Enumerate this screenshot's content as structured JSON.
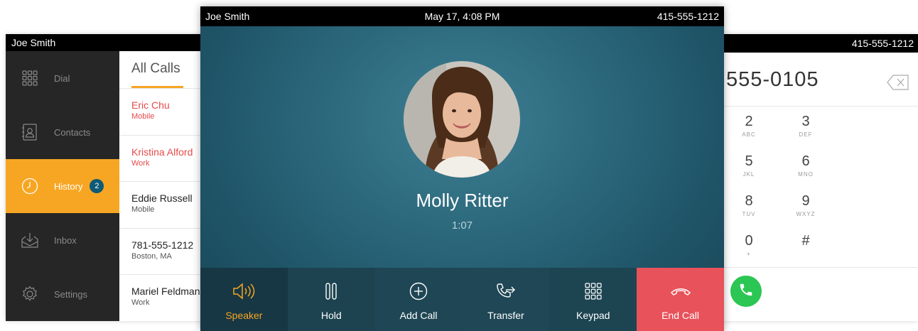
{
  "colors": {
    "accent": "#f7a623",
    "end_call": "#e8525a",
    "answer": "#2bc653",
    "missed": "#e84a4a",
    "badge": "#0e5a77"
  },
  "left": {
    "user_name": "Joe Smith",
    "sidebar": [
      {
        "label": "Dial",
        "icon": "keypad-icon"
      },
      {
        "label": "Contacts",
        "icon": "contacts-icon"
      },
      {
        "label": "History",
        "icon": "clock-icon",
        "badge": "2",
        "active": true
      },
      {
        "label": "Inbox",
        "icon": "inbox-icon"
      },
      {
        "label": "Settings",
        "icon": "gear-icon"
      }
    ],
    "tab_title": "All Calls",
    "calls": [
      {
        "name": "Eric Chu",
        "sub": "Mobile",
        "missed": true
      },
      {
        "name": "Kristina Alford",
        "sub": "Work",
        "missed": true
      },
      {
        "name": "Eddie Russell",
        "sub": "Mobile",
        "missed": false
      },
      {
        "name": "781-555-1212",
        "sub": "Boston, MA",
        "missed": false
      },
      {
        "name": "Mariel Feldman",
        "sub": "Work",
        "missed": false
      }
    ]
  },
  "center": {
    "user_name": "Joe Smith",
    "datetime": "May 17, 4:08 PM",
    "phone": "415-555-1212",
    "caller_name": "Molly Ritter",
    "call_duration": "1:07",
    "controls": [
      {
        "label": "Speaker",
        "icon": "speaker-icon"
      },
      {
        "label": "Hold",
        "icon": "pause-icon"
      },
      {
        "label": "Add Call",
        "icon": "add-circle-icon"
      },
      {
        "label": "Transfer",
        "icon": "transfer-icon"
      },
      {
        "label": "Keypad",
        "icon": "keypad-icon"
      },
      {
        "label": "End Call",
        "icon": "hangup-icon"
      }
    ]
  },
  "right": {
    "phone": "415-555-1212",
    "dialed_number": "555-0105",
    "keys": [
      {
        "digit": "2",
        "letters": "ABC"
      },
      {
        "digit": "3",
        "letters": "DEF"
      },
      {
        "digit": "5",
        "letters": "JKL"
      },
      {
        "digit": "6",
        "letters": "MNO"
      },
      {
        "digit": "8",
        "letters": "TUV"
      },
      {
        "digit": "9",
        "letters": "WXYZ"
      },
      {
        "digit": "0",
        "letters": "+"
      },
      {
        "digit": "#",
        "letters": ""
      }
    ]
  }
}
